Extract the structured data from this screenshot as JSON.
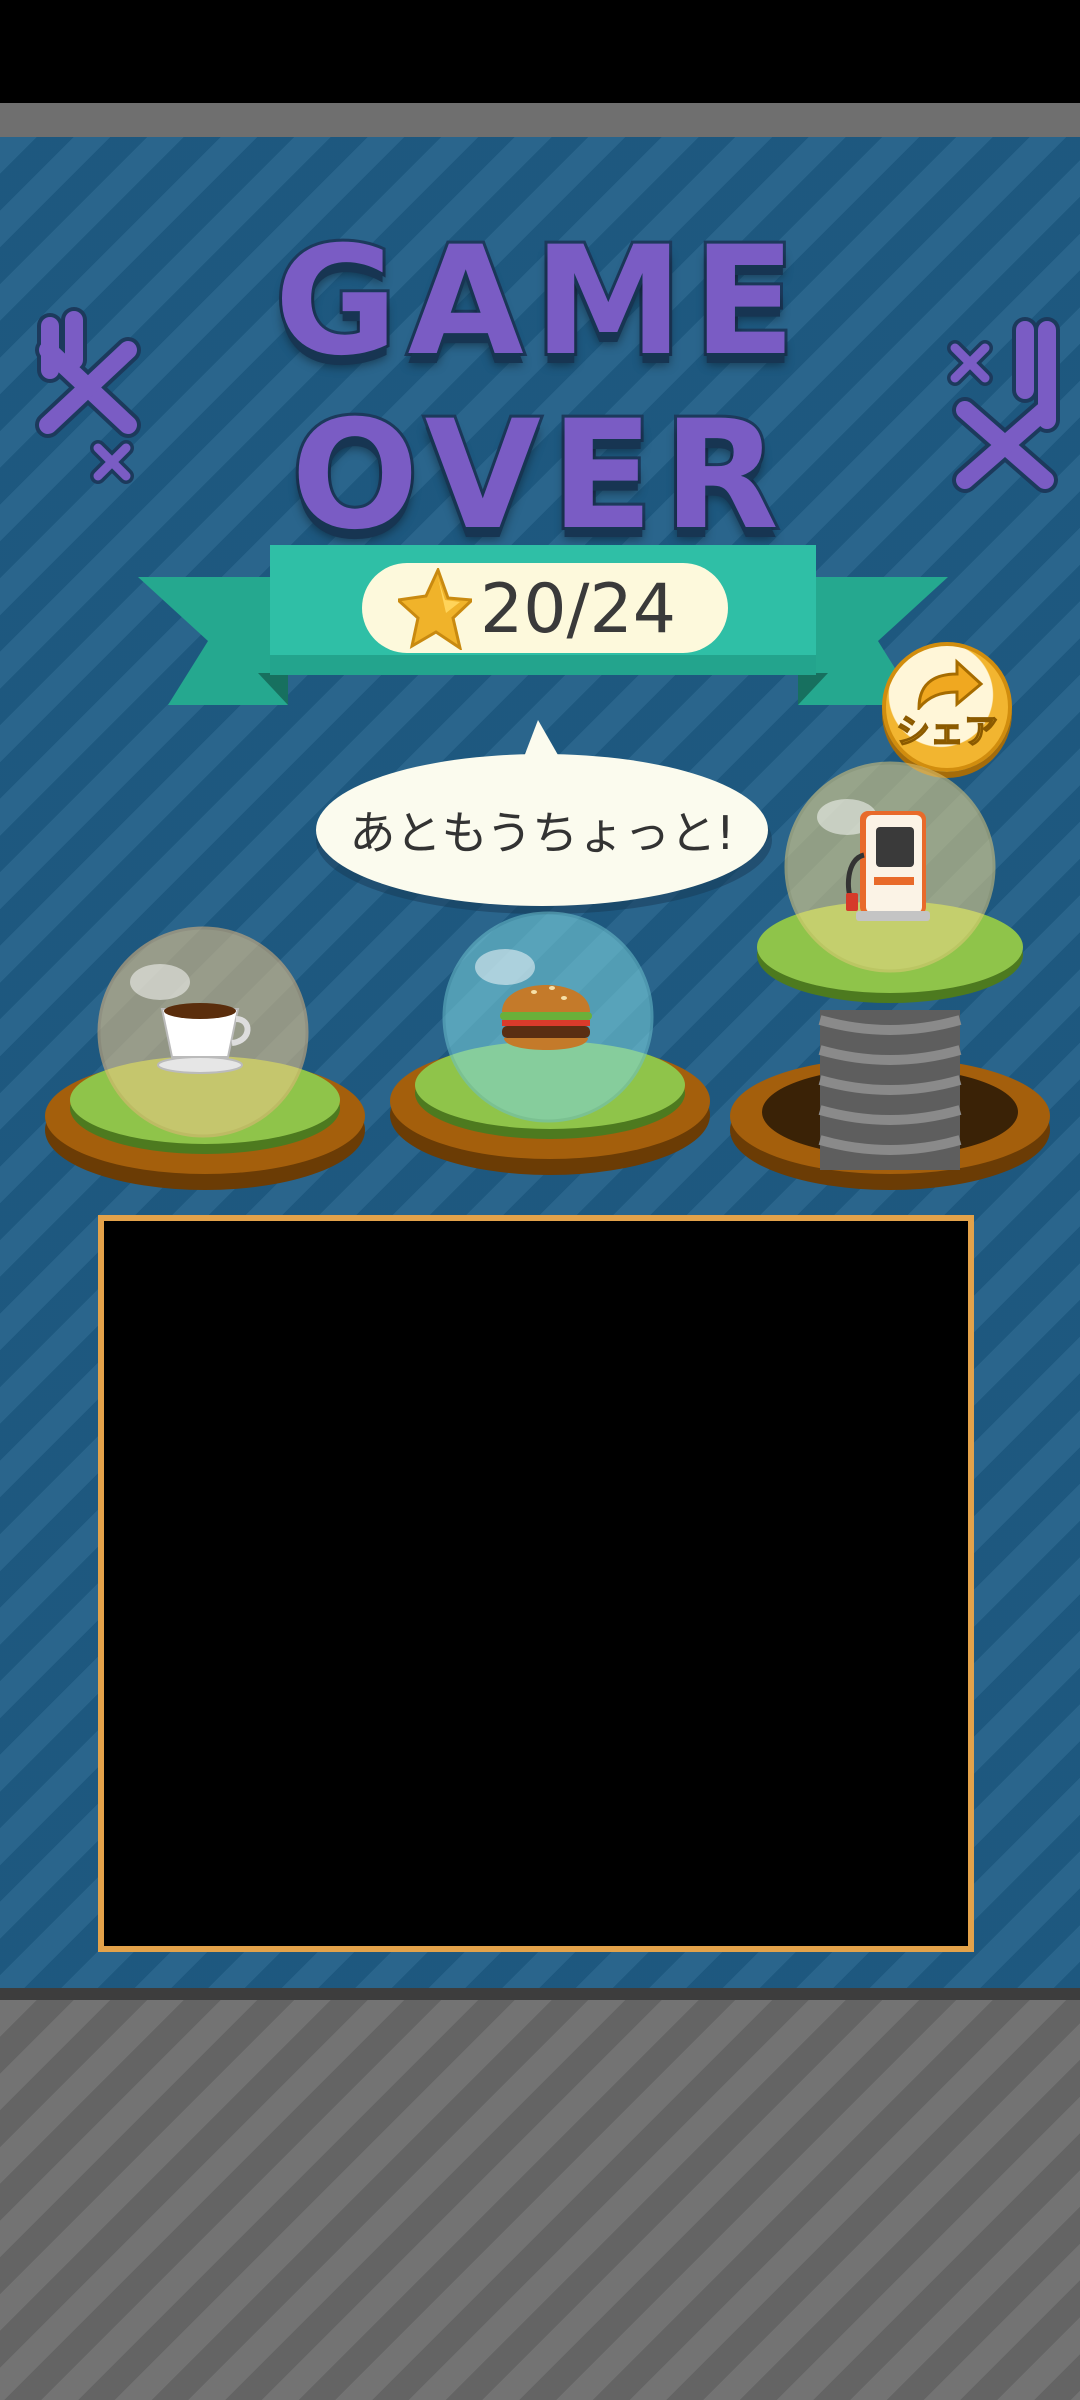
{
  "game": {
    "title": "GAME OVER",
    "score": "20/24",
    "share_label": "シェア",
    "message": "あともうちょっと!"
  },
  "items": [
    {
      "icon": "coffee-cup-icon",
      "bubble_color": "#f2c98a"
    },
    {
      "icon": "hamburger-icon",
      "bubble_color": "#7fd6e0"
    },
    {
      "icon": "gas-pump-icon",
      "bubble_color": "#f0d88a"
    }
  ],
  "colors": {
    "panel": "#1f5d86",
    "title": "#7a5cc4",
    "ribbon": "#2fbfa6",
    "frame": "#e3a24a"
  }
}
